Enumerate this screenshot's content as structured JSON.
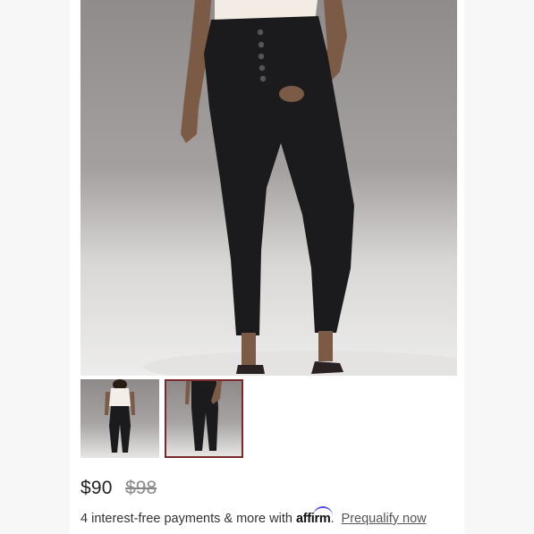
{
  "product": {
    "main_image": "black-skinny-jeans-model-photo",
    "thumbnails": [
      {
        "name": "full-outfit-thumbnail",
        "selected": false
      },
      {
        "name": "jeans-closeup-thumbnail",
        "selected": true
      }
    ],
    "price": {
      "current": "$90",
      "original": "$98"
    },
    "financing": {
      "text": "4 interest-free payments & more with",
      "logo": "affirm",
      "period": ".",
      "link": "Prequalify now"
    }
  },
  "colors": {
    "selected_border": "#7a2a2a",
    "affirm_arc": "#4a4af4"
  }
}
